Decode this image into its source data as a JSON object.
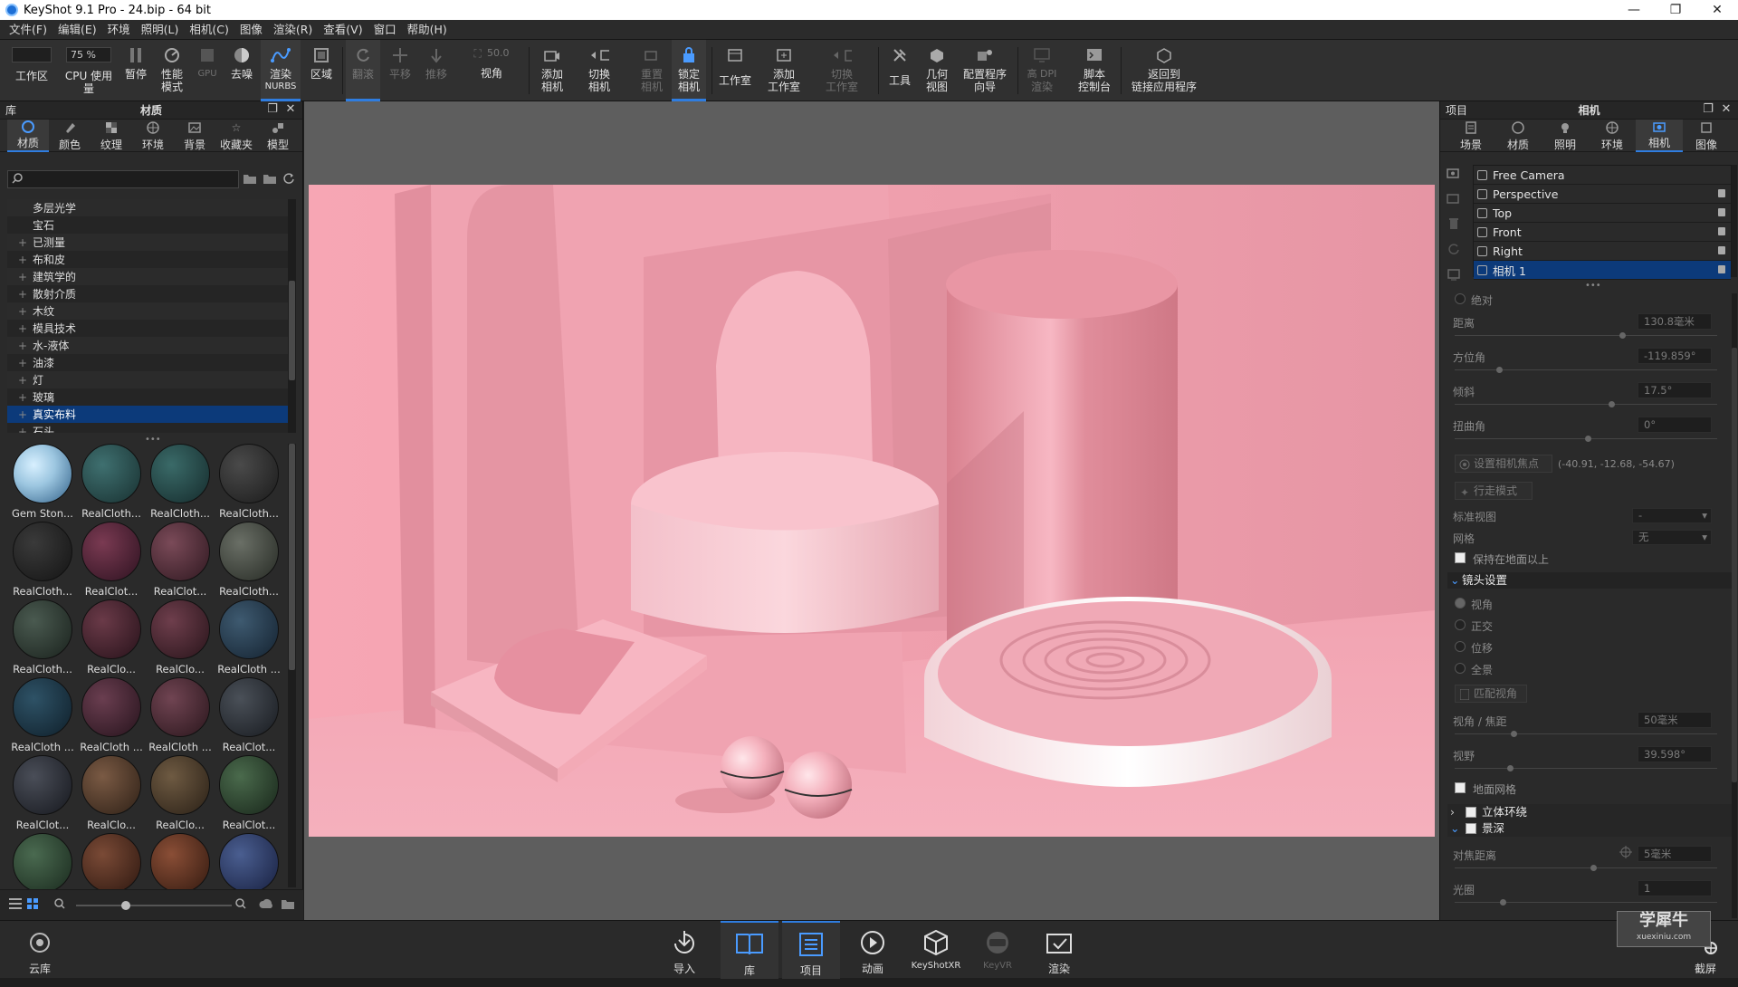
{
  "window": {
    "title": "KeyShot 9.1 Pro  - 24.bip  - 64 bit",
    "min": "—",
    "max": "❐",
    "close": "✕"
  },
  "menu": [
    "文件(F)",
    "编辑(E)",
    "环境",
    "照明(L)",
    "相机(C)",
    "图像",
    "渲染(R)",
    "查看(V)",
    "窗口",
    "帮助(H)"
  ],
  "toolbar": {
    "workspace_label": "工作区",
    "cpu_percent": "75 %",
    "cpu_label": "CPU 使用量",
    "pause_label": "暂停",
    "perf_label_1": "性能",
    "perf_label_2": "模式",
    "gpu_label": "GPU",
    "denoise_label": "去噪",
    "nurbs_label_1": "渲染",
    "nurbs_label_2": "NURBS",
    "region_label": "区域",
    "tumble_label": "翻滚",
    "pan_label": "平移",
    "dolly_label": "推移",
    "fov_value": "50.0",
    "fov_label": "视角",
    "add_cam_1": "添加",
    "add_cam_2": "相机",
    "switch_cam_1": "切换",
    "switch_cam_2": "相机",
    "reset_cam_1": "重置",
    "reset_cam_2": "相机",
    "lock_cam_1": "锁定",
    "lock_cam_2": "相机",
    "studio_label": "工作室",
    "add_studio_1": "添加",
    "add_studio_2": "工作室",
    "switch_studio_1": "切换",
    "switch_studio_2": "工作室",
    "tools_label": "工具",
    "geo_view_1": "几何",
    "geo_view_2": "视图",
    "config_1": "配置程序",
    "config_2": "向导",
    "hidpi_1": "高 DPI",
    "hidpi_2": "渲染",
    "script_1": "脚本",
    "script_2": "控制台",
    "back_1": "返回到",
    "back_2": "链接应用程序"
  },
  "library": {
    "header": "库",
    "title": "材质",
    "tabs": [
      "材质",
      "颜色",
      "纹理",
      "环境",
      "背景",
      "收藏夹",
      "模型"
    ],
    "tree": [
      {
        "label": "多层光学",
        "expand": ""
      },
      {
        "label": "宝石",
        "expand": ""
      },
      {
        "label": "已测量",
        "expand": "+"
      },
      {
        "label": "布和皮",
        "expand": "+"
      },
      {
        "label": "建筑学的",
        "expand": "+"
      },
      {
        "label": "散射介质",
        "expand": "+"
      },
      {
        "label": "木纹",
        "expand": "+"
      },
      {
        "label": "模具技术",
        "expand": "+"
      },
      {
        "label": "水-液体",
        "expand": "+"
      },
      {
        "label": "油漆",
        "expand": "+"
      },
      {
        "label": "灯",
        "expand": "+"
      },
      {
        "label": "玻璃",
        "expand": "+"
      },
      {
        "label": "真实布料",
        "expand": "+"
      },
      {
        "label": "石头",
        "expand": "+"
      }
    ],
    "thumbs": [
      {
        "name": "Gem Ston...",
        "c1": "#9cc6e0",
        "c2": "#2f5e86"
      },
      {
        "name": "RealCloth...",
        "c1": "#3f7070",
        "c2": "#183030"
      },
      {
        "name": "RealCloth...",
        "c1": "#3a6a68",
        "c2": "#152b2c"
      },
      {
        "name": "RealCloth...",
        "c1": "#4a4a4a",
        "c2": "#1b1b1b"
      },
      {
        "name": "RealCloth...",
        "c1": "#3a3a3a",
        "c2": "#141414"
      },
      {
        "name": "RealClot...",
        "c1": "#7a3a52",
        "c2": "#2d1220"
      },
      {
        "name": "RealClot...",
        "c1": "#7a4a58",
        "c2": "#2f1820"
      },
      {
        "name": "RealCloth...",
        "c1": "#6a6f66",
        "c2": "#262a24"
      },
      {
        "name": "RealCloth...",
        "c1": "#4a5a50",
        "c2": "#1a221d"
      },
      {
        "name": "RealClo...",
        "c1": "#6a3a48",
        "c2": "#27121a"
      },
      {
        "name": "RealClo...",
        "c1": "#6e3e4c",
        "c2": "#28141a"
      },
      {
        "name": "RealCloth ...",
        "c1": "#3e5a70",
        "c2": "#142230"
      },
      {
        "name": "RealCloth ...",
        "c1": "#2e5266",
        "c2": "#0f1f2a"
      },
      {
        "name": "RealCloth ...",
        "c1": "#6a3e50",
        "c2": "#26131c"
      },
      {
        "name": "RealCloth ...",
        "c1": "#704452",
        "c2": "#2a161c"
      },
      {
        "name": "RealClot...",
        "c1": "#4a5058",
        "c2": "#181b20"
      },
      {
        "name": "RealClot...",
        "c1": "#4a4e58",
        "c2": "#16181e"
      },
      {
        "name": "RealClo...",
        "c1": "#7a5a44",
        "c2": "#2e2016"
      },
      {
        "name": "RealClo...",
        "c1": "#6e5a42",
        "c2": "#2a2016"
      },
      {
        "name": "RealClot...",
        "c1": "#4a6a4c",
        "c2": "#18261a"
      },
      {
        "name": "",
        "c1": "#4a6a50",
        "c2": "#1a2a1e"
      },
      {
        "name": "",
        "c1": "#7a4a36",
        "c2": "#2e1810"
      },
      {
        "name": "",
        "c1": "#8a4e36",
        "c2": "#331a10"
      },
      {
        "name": "",
        "c1": "#4a5e90",
        "c2": "#182040"
      }
    ]
  },
  "project": {
    "header": "项目",
    "title": "相机",
    "tabs": [
      "场景",
      "材质",
      "照明",
      "环境",
      "相机",
      "图像"
    ],
    "cameras": [
      {
        "name": "Free Camera",
        "locked": false,
        "selected": false
      },
      {
        "name": "Perspective",
        "locked": true,
        "selected": false
      },
      {
        "name": "Top",
        "locked": true,
        "selected": false
      },
      {
        "name": "Front",
        "locked": true,
        "selected": false
      },
      {
        "name": "Right",
        "locked": true,
        "selected": false
      },
      {
        "name": "相机 1",
        "locked": true,
        "selected": true
      }
    ],
    "absolute": "绝对",
    "distance_label": "距离",
    "distance_value": "130.8毫米",
    "azimuth_label": "方位角",
    "azimuth_value": "-119.859°",
    "incline_label": "倾斜",
    "incline_value": "17.5°",
    "twist_label": "扭曲角",
    "twist_value": "0°",
    "focus_btn": "设置相机焦点",
    "focus_coords": "(-40.91, -12.68, -54.67)",
    "walk_btn": "行走模式",
    "std_view_label": "标准视图",
    "std_view_value": "-",
    "grid_label": "网格",
    "grid_value": "无",
    "keep_above": "保持在地面以上",
    "lens_section": "镜头设置",
    "lens_opts": [
      "视角",
      "正交",
      "位移",
      "全景"
    ],
    "match_btn": "匹配视角",
    "fov_focal_label": "视角 / 焦距",
    "fov_focal_value": "50毫米",
    "fov_label": "视野",
    "fov_value": "39.598°",
    "ground_grid": "地面网格",
    "stereo": "立体环绕",
    "dof": "景深",
    "focus_dist_label": "对焦距离",
    "focus_dist_value": "5毫米",
    "aperture_label": "光圈",
    "aperture_value": "1"
  },
  "bottom": {
    "cloud": "云库",
    "import": "导入",
    "library": "库",
    "project": "项目",
    "animation": "动画",
    "keyshotxr": "KeyShotXR",
    "keyvr": "KeyVR",
    "render": "渲染",
    "screenshot": "截屏"
  },
  "watermark": {
    "main": "学犀牛",
    "sub": "xuexiniu.com"
  },
  "colors": {
    "accent": "#2f7de0",
    "select": "#0c3a7a",
    "scene_pink": "#f0a4b4"
  }
}
